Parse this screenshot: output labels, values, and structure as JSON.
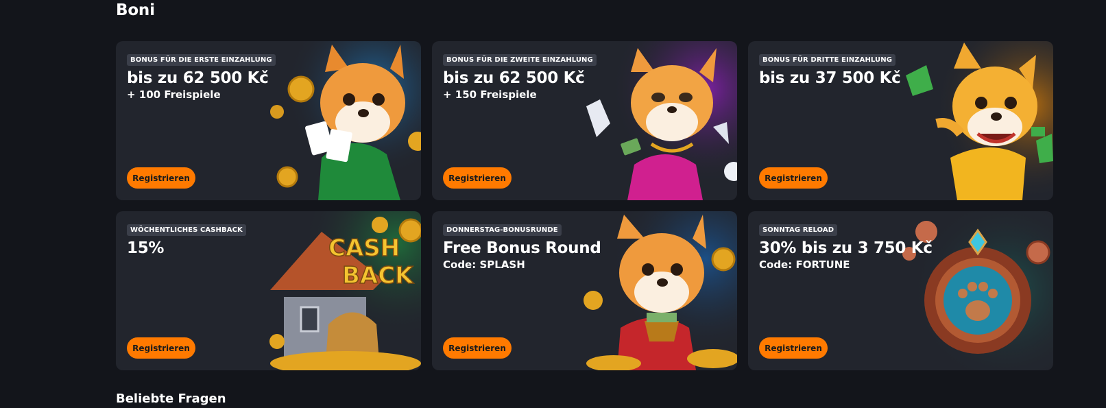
{
  "page": {
    "section_title": "Boni",
    "faq_title": "Beliebte Fragen"
  },
  "cards": [
    {
      "badge": "Bonus für die erste Einzahlung",
      "headline": "bis zu 62 500 Kč",
      "subline": "+ 100 Freispiele",
      "button": "Registrieren",
      "art": "fox-green-hoodie-cards-icon",
      "art_bg": "#1c5a8a"
    },
    {
      "badge": "Bonus für die zweite Einzahlung",
      "headline": " bis zu 62 500 Kč",
      "subline": "+ 150 Freispiele",
      "button": "Registrieren",
      "art": "fox-pink-dress-diamonds-icon",
      "art_bg": "#6b1f8a"
    },
    {
      "badge": "Bonus für dritte Einzahlung",
      "headline": "bis zu 37 500 Kč",
      "subline": "",
      "button": "Registrieren",
      "art": "fox-yellow-shirt-money-icon",
      "art_bg": "#a86410"
    },
    {
      "badge": "Wöchentliches Cashback",
      "headline": "15%",
      "subline": "",
      "button": "Registrieren",
      "art": "cashback-house-coins-icon",
      "art_bg": "#1f5a3a",
      "art_text": [
        "CASH",
        "BACK"
      ]
    },
    {
      "badge": "Donnerstag-Bonusrunde",
      "headline": "Free Bonus Round",
      "subline": "Code: SPLASH",
      "button": "Registrieren",
      "art": "fox-money-pot-coins-icon",
      "art_bg": "#1c4f86"
    },
    {
      "badge": "Sonntag Reload",
      "headline": "30% bis zu 3 750 Kč",
      "subline": "Code: FORTUNE",
      "button": "Registrieren",
      "art": "paw-medallion-icon",
      "art_bg": "#1d4f4c"
    }
  ],
  "colors": {
    "page_bg": "#13151b",
    "card_bg": "#22252d",
    "badge_bg": "#3b3f4a",
    "button_bg": "#ff7a00",
    "gold": "#e3a521"
  }
}
